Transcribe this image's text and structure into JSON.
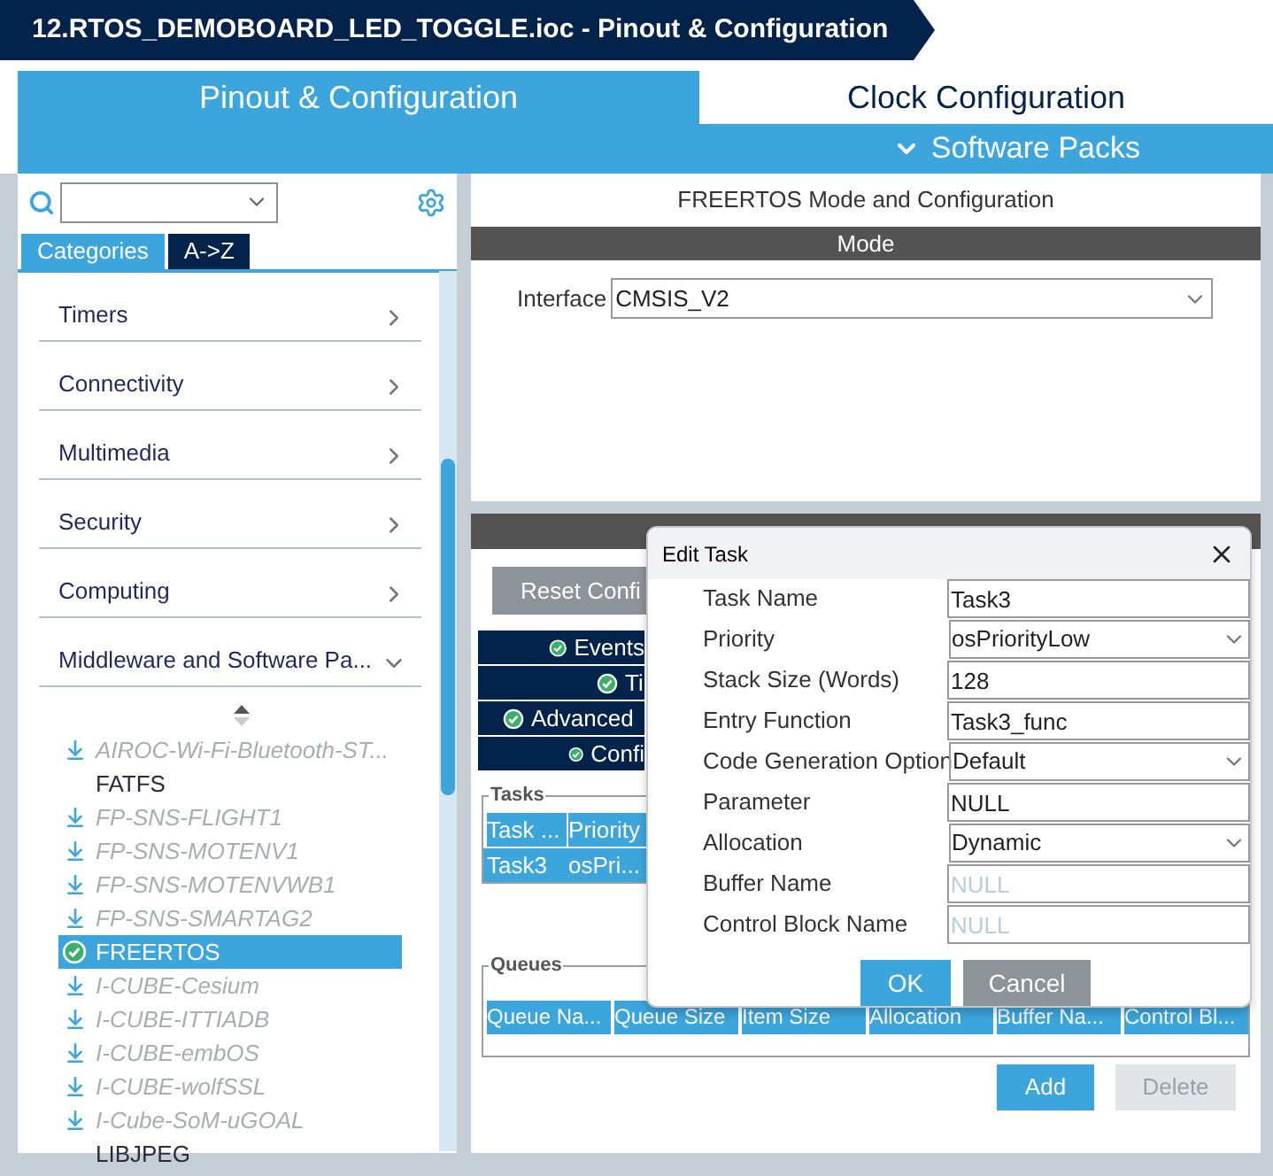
{
  "title_bar": {
    "title": "12.RTOS_DEMOBOARD_LED_TOGGLE.ioc - Pinout & Configuration"
  },
  "tabs": [
    {
      "label": "Pinout & Configuration",
      "selected": true
    },
    {
      "label": "Clock Configuration",
      "selected": false
    }
  ],
  "software_packs": {
    "label": "Software Packs"
  },
  "sidebar": {
    "view_tabs": [
      {
        "label": "Categories",
        "selected": true
      },
      {
        "label": "A->Z",
        "selected": false
      }
    ],
    "categories": [
      {
        "label": "Timers",
        "expanded": false
      },
      {
        "label": "Connectivity",
        "expanded": false
      },
      {
        "label": "Multimedia",
        "expanded": false
      },
      {
        "label": "Security",
        "expanded": false
      },
      {
        "label": "Computing",
        "expanded": false
      },
      {
        "label": "Middleware and Software Pa...",
        "expanded": true
      }
    ],
    "items": [
      {
        "label": "AIROC-Wi-Fi-Bluetooth-ST...",
        "kind": "pack",
        "selected": false
      },
      {
        "label": "FATFS",
        "kind": "plain",
        "selected": false
      },
      {
        "label": "FP-SNS-FLIGHT1",
        "kind": "pack",
        "selected": false
      },
      {
        "label": "FP-SNS-MOTENV1",
        "kind": "pack",
        "selected": false
      },
      {
        "label": "FP-SNS-MOTENVWB1",
        "kind": "pack",
        "selected": false
      },
      {
        "label": "FP-SNS-SMARTAG2",
        "kind": "pack",
        "selected": false
      },
      {
        "label": "FREERTOS",
        "kind": "enabled",
        "selected": true
      },
      {
        "label": "I-CUBE-Cesium",
        "kind": "pack",
        "selected": false
      },
      {
        "label": "I-CUBE-ITTIADB",
        "kind": "pack",
        "selected": false
      },
      {
        "label": "I-CUBE-embOS",
        "kind": "pack",
        "selected": false
      },
      {
        "label": "I-CUBE-wolfSSL",
        "kind": "pack",
        "selected": false
      },
      {
        "label": "I-Cube-SoM-uGOAL",
        "kind": "pack",
        "selected": false
      },
      {
        "label": "LIBJPEG",
        "kind": "plain",
        "selected": false
      }
    ]
  },
  "panel": {
    "title": "FREERTOS Mode and Configuration",
    "mode_header": "Mode",
    "interface": {
      "label": "Interface",
      "value": "CMSIS_V2"
    }
  },
  "configuration": {
    "reset_button": "Reset Confi",
    "tabs": [
      {
        "label": "Events"
      },
      {
        "label": "Ti"
      },
      {
        "label": "Advanced"
      },
      {
        "label": "Confi"
      }
    ],
    "tasks": {
      "legend": "Tasks",
      "columns": [
        "Task ...",
        "Priority"
      ],
      "rows": [
        [
          "Task3",
          "osPri..."
        ]
      ]
    },
    "queues": {
      "legend": "Queues",
      "columns": [
        "Queue Na...",
        "Queue Size",
        "Item Size",
        "Allocation",
        "Buffer Na...",
        "Control Bl..."
      ]
    },
    "buttons": [
      {
        "label": "Add",
        "disabled": false
      },
      {
        "label": "Delete",
        "disabled": true
      }
    ]
  },
  "dialog": {
    "title": "Edit Task",
    "fields": [
      {
        "label": "Task Name",
        "kind": "text",
        "value": "Task3"
      },
      {
        "label": "Priority",
        "kind": "select",
        "value": "osPriorityLow"
      },
      {
        "label": "Stack Size (Words)",
        "kind": "text",
        "value": "128"
      },
      {
        "label": "Entry Function",
        "kind": "text",
        "value": "Task3_func"
      },
      {
        "label": "Code Generation Option",
        "kind": "select",
        "value": "Default"
      },
      {
        "label": "Parameter",
        "kind": "text",
        "value": "NULL"
      },
      {
        "label": "Allocation",
        "kind": "select",
        "value": "Dynamic"
      },
      {
        "label": "Buffer Name",
        "kind": "text",
        "placeholder": "NULL"
      },
      {
        "label": "Control Block Name",
        "kind": "text",
        "placeholder": "NULL"
      }
    ],
    "buttons": [
      {
        "label": "OK",
        "kind": "primary"
      },
      {
        "label": "Cancel",
        "kind": "secondary"
      }
    ]
  }
}
